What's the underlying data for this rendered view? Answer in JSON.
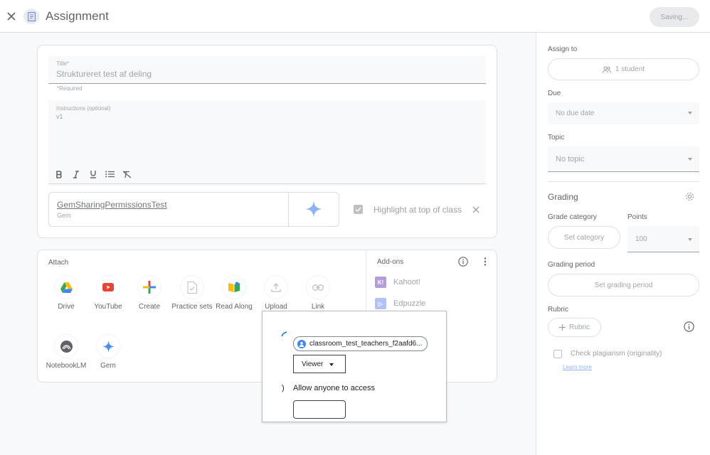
{
  "header": {
    "title": "Assignment",
    "saving_label": "Saving..."
  },
  "form": {
    "title_label": "Title*",
    "title_value": "Struktureret test af deling",
    "required_note": "*Required",
    "instructions_label": "Instructions (optional)",
    "instructions_value": "v1",
    "gem": {
      "name": "GemSharingPermissionsTest",
      "type": "Gem"
    },
    "highlight_label": "Highlight at top of class"
  },
  "attach": {
    "title": "Attach",
    "items": [
      {
        "label": "Drive",
        "icon": "drive-icon"
      },
      {
        "label": "YouTube",
        "icon": "youtube-icon"
      },
      {
        "label": "Create",
        "icon": "create-icon"
      },
      {
        "label": "Practice sets",
        "icon": "practice-sets-icon"
      },
      {
        "label": "Read Along",
        "icon": "read-along-icon"
      },
      {
        "label": "Upload",
        "icon": "upload-icon"
      },
      {
        "label": "Link",
        "icon": "link-icon"
      },
      {
        "label": "NotebookLM",
        "icon": "notebooklm-icon"
      },
      {
        "label": "Gem",
        "icon": "gem-icon"
      }
    ]
  },
  "addons": {
    "title": "Add-ons",
    "items": [
      {
        "label": "Kahoot!",
        "color": "#46178f"
      },
      {
        "label": "Edpuzzle",
        "color": "#637bfe"
      }
    ]
  },
  "right_panel": {
    "assign_to_label": "Assign to",
    "assign_to_value": "1 student",
    "due_label": "Due",
    "due_value": "No due date",
    "topic_label": "Topic",
    "topic_value": "No topic",
    "grading_title": "Grading",
    "grade_category_label": "Grade category",
    "grade_category_button": "Set category",
    "points_label": "Points",
    "points_value": "100",
    "grading_period_label": "Grading period",
    "grading_period_button": "Set grading period",
    "rubric_label": "Rubric",
    "rubric_button": "Rubric",
    "plagiarism_label": "Check plagiarism (originality)",
    "learn_more": "Learn more"
  },
  "share_popup": {
    "user_email": "classroom_test_teachers_f2aafd6...",
    "role": "Viewer",
    "paren": ")",
    "allow_label": "Allow anyone to access"
  }
}
